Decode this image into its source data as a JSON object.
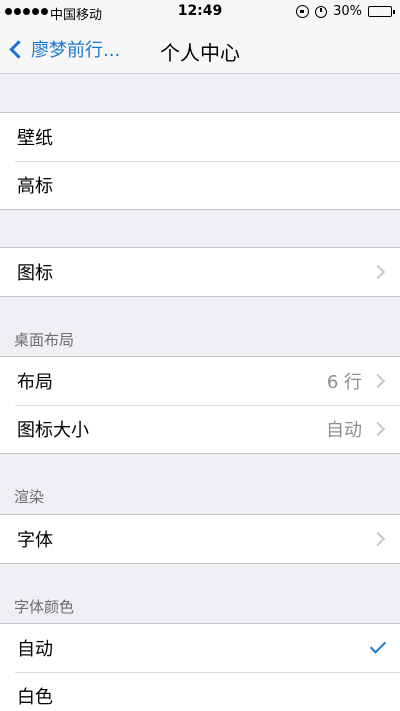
{
  "status": {
    "carrier": "中国移动",
    "time": "12:49",
    "battery": "30%",
    "battery_level": 0.3
  },
  "nav": {
    "back_label": "廖梦前行...",
    "title": "个人中心"
  },
  "groups": [
    {
      "header": "",
      "rows": [
        {
          "label": "壁纸"
        },
        {
          "label": "高标"
        }
      ]
    },
    {
      "header": "",
      "rows": [
        {
          "label": "图标",
          "disclosure": true
        }
      ]
    },
    {
      "header": "桌面布局",
      "rows": [
        {
          "label": "布局",
          "value": "6 行",
          "disclosure": true
        },
        {
          "label": "图标大小",
          "value": "自动",
          "disclosure": true
        }
      ]
    },
    {
      "header": "渲染",
      "rows": [
        {
          "label": "字体",
          "disclosure": true
        }
      ]
    },
    {
      "header": "字体颜色",
      "rows": [
        {
          "label": "自动",
          "checked": true
        },
        {
          "label": "白色"
        }
      ]
    }
  ],
  "colors": {
    "accent": "#1b76d2",
    "background": "#efeff4",
    "header_text": "#6d6d72",
    "value_text": "#8e8e93"
  }
}
